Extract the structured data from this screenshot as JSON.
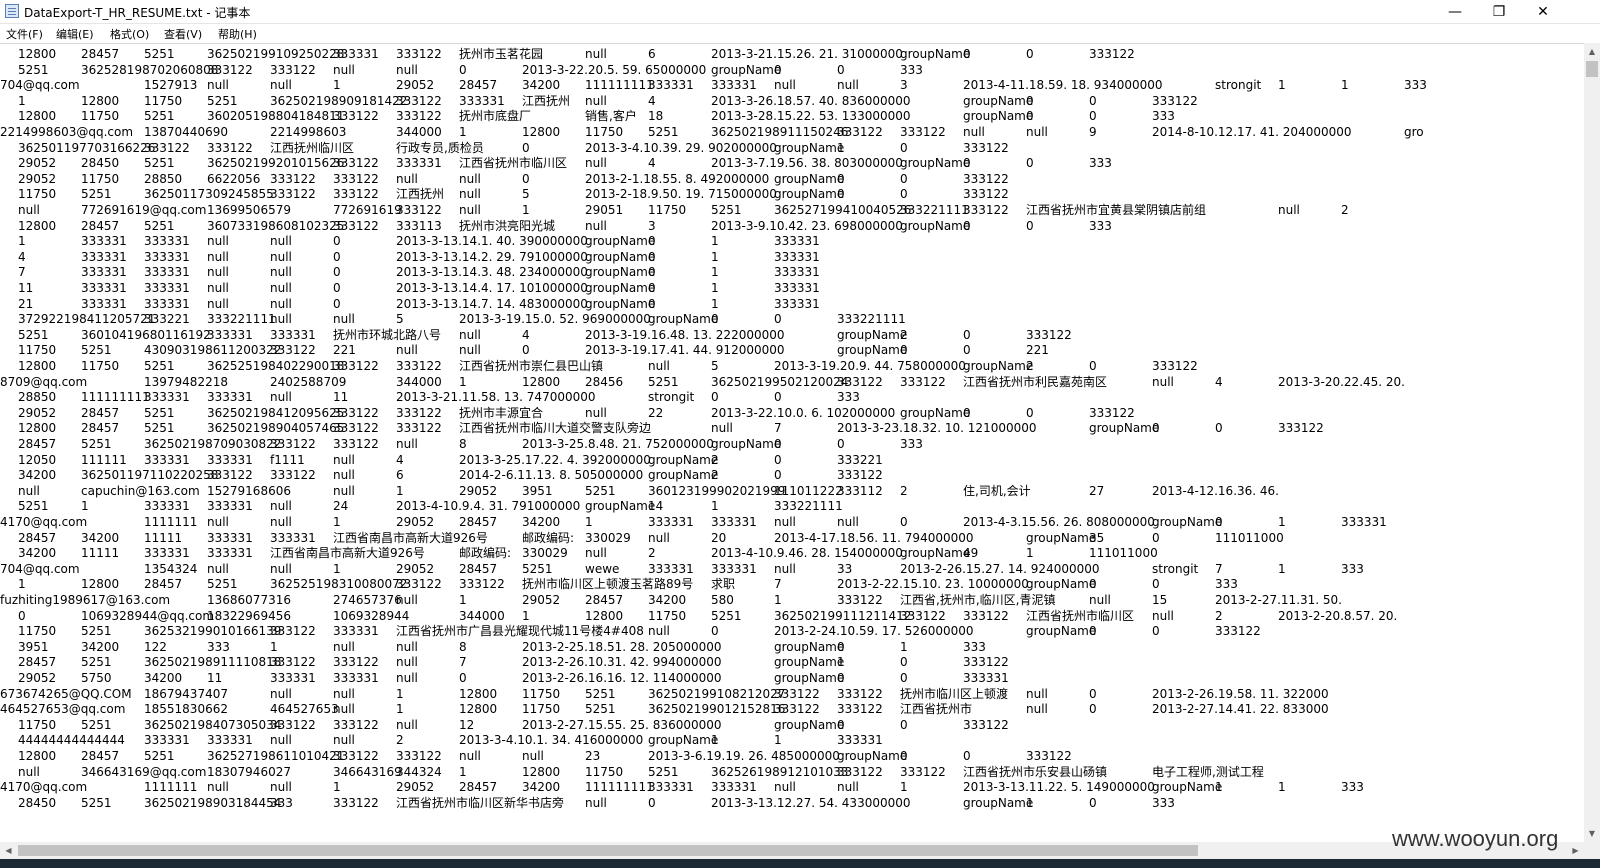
{
  "window": {
    "title": "DataExport-T_HR_RESUME.txt - 记事本",
    "minimize_glyph": "—",
    "maximize_glyph": "❐",
    "close_glyph": "✕"
  },
  "menu": [
    "文件(F)",
    "编辑(E)",
    "格式(O)",
    "查看(V)",
    "帮助(H)"
  ],
  "lines": [
    [
      "12800",
      "28457",
      "5251",
      "362502199109250228",
      "333331",
      "333122",
      "抚州市玉茗花园",
      "null",
      "6",
      "2013-3-21.15.26. 21. 31000000",
      "groupName",
      "0",
      "0",
      "333122"
    ],
    [
      "5251",
      "362528198702060808",
      "333122",
      "333122",
      "null",
      "null",
      "0",
      "2013-3-22.20.5. 59. 65000000",
      "groupName",
      "0",
      "0",
      "333"
    ],
    [
      "704@qq.com",
      "1527913",
      "null",
      "null",
      "1",
      "29052",
      "28457",
      "34200",
      "111111111",
      "333331",
      "333331",
      "null",
      "null",
      "3",
      "2013-4-11.18.59. 18. 934000000",
      "strongit",
      "1",
      "1",
      "333"
    ],
    [
      "1",
      "12800",
      "11750",
      "5251",
      "362502198909181422",
      "333122",
      "333331",
      "江西抚州",
      "null",
      "4",
      "2013-3-26.18.57. 40. 836000000",
      "groupName",
      "0",
      "0",
      "333122"
    ],
    [
      "12800",
      "11750",
      "5251",
      "360205198804184811",
      "333122",
      "333122",
      "抚州市底盘厂",
      "销售,客户",
      "18",
      "2013-3-28.15.22. 53. 133000000",
      "groupName",
      "0",
      "0",
      "333"
    ],
    [
      "2214998603@qq.com",
      "13870440690",
      "2214998603",
      "344000",
      "1",
      "12800",
      "11750",
      "5251",
      "362502198911150246",
      "333122",
      "333122",
      "null",
      "null",
      "9",
      "2014-8-10.12.17. 41. 204000000",
      "gro"
    ],
    [
      "362501197703166226",
      "333122",
      "333122",
      "江西抚州临川区",
      "行政专员,质检员",
      "0",
      "2013-3-4.10.39. 29. 902000000",
      "groupName",
      "1",
      "0",
      "333122"
    ],
    [
      "29052",
      "28450",
      "5251",
      "362502199201015626",
      "333122",
      "333331",
      "江西省抚州市临川区",
      "null",
      "4",
      "2013-3-7.19.56. 38. 803000000",
      "groupName",
      "0",
      "0",
      "333"
    ],
    [
      "29052",
      "11750",
      "28850",
      "6622056",
      "333122",
      "333122",
      "null",
      "null",
      "0",
      "2013-2-1.18.55. 8. 492000000",
      "groupName",
      "0",
      "0",
      "333122"
    ],
    [
      "11750",
      "5251",
      "36250117309245855",
      "333122",
      "333122",
      "江西抚州",
      "null",
      "5",
      "2013-2-18.9.50. 19. 715000000",
      "groupName",
      "0",
      "0",
      "333122"
    ],
    [
      "null",
      "772691619@qq.com",
      "13699506579",
      "772691619",
      "333122",
      "null",
      "1",
      "29051",
      "11750",
      "5251",
      "362527199410040526",
      "333221111",
      "333122",
      "江西省抚州市宜黄县棠阴镇店前组",
      "null",
      "2"
    ],
    [
      "12800",
      "28457",
      "5251",
      "360733198608102325",
      "333122",
      "333113",
      "抚州市洪亮阳光城",
      "null",
      "3",
      "2013-3-9.10.42. 23. 698000000",
      "groupName",
      "0",
      "0",
      "333"
    ],
    [
      "1",
      "333331",
      "333331",
      "null",
      "null",
      "0",
      "2013-3-13.14.1. 40. 390000000",
      "groupName",
      "0",
      "1",
      "333331"
    ],
    [
      "4",
      "333331",
      "333331",
      "null",
      "null",
      "0",
      "2013-3-13.14.2. 29. 791000000",
      "groupName",
      "0",
      "1",
      "333331"
    ],
    [
      "7",
      "333331",
      "333331",
      "null",
      "null",
      "0",
      "2013-3-13.14.3. 48. 234000000",
      "groupName",
      "0",
      "1",
      "333331"
    ],
    [
      "11",
      "333331",
      "333331",
      "null",
      "null",
      "0",
      "2013-3-13.14.4. 17. 101000000",
      "groupName",
      "0",
      "1",
      "333331"
    ],
    [
      "21",
      "333331",
      "333331",
      "null",
      "null",
      "0",
      "2013-3-13.14.7. 14. 483000000",
      "groupName",
      "0",
      "1",
      "333331"
    ],
    [
      "372922198411205721",
      "333221",
      "333221111",
      "null",
      "null",
      "5",
      "2013-3-19.15.0. 52. 969000000",
      "groupName",
      "0",
      "0",
      "333221111"
    ],
    [
      "5251",
      "36010419680116192",
      "333331",
      "333331",
      "抚州市环城北路八号",
      "null",
      "4",
      "2013-3-19.16.48. 13. 222000000",
      "groupName",
      "2",
      "0",
      "333122"
    ],
    [
      "11750",
      "5251",
      "430903198611200322",
      "333122",
      "221",
      "null",
      "null",
      "0",
      "2013-3-19.17.41. 44. 912000000",
      "groupName",
      "0",
      "0",
      "221"
    ],
    [
      "12800",
      "11750",
      "5251",
      "362525198402290018",
      "333122",
      "333122",
      "江西省抚州市崇仁县巴山镇",
      "null",
      "5",
      "2013-3-19.20.9. 44. 758000000",
      "groupName",
      "2",
      "0",
      "333122"
    ],
    [
      "8709@qq.com",
      "13979482218",
      "2402588709",
      "344000",
      "1",
      "12800",
      "28456",
      "5251",
      "362502199502120024",
      "333122",
      "333122",
      "江西省抚州市利民嘉苑南区",
      "null",
      "4",
      "2013-3-20.22.45. 20."
    ],
    [
      "28850",
      "111111111",
      "333331",
      "333331",
      "null",
      "11",
      "2013-3-21.11.58. 13. 747000000",
      "strongit",
      "0",
      "0",
      "333"
    ],
    [
      "29052",
      "28457",
      "5251",
      "362502198412095625",
      "333122",
      "333122",
      "抚州市丰源宜合",
      "null",
      "22",
      "2013-3-22.10.0. 6. 102000000",
      "groupName",
      "0",
      "0",
      "333122"
    ],
    [
      "12800",
      "28457",
      "5251",
      "362502198904057465",
      "333122",
      "333122",
      "江西省抚州市临川大道交警支队旁边",
      "null",
      "7",
      "2013-3-23.18.32. 10. 121000000",
      "groupName",
      "0",
      "0",
      "333122"
    ],
    [
      "28457",
      "5251",
      "362502198709030822",
      "333122",
      "333122",
      "null",
      "8",
      "2013-3-25.8.48. 21. 752000000",
      "groupName",
      "0",
      "0",
      "333"
    ],
    [
      "12050",
      "111111",
      "333331",
      "333331",
      "f1111",
      "null",
      "4",
      "2013-3-25.17.22. 4. 392000000",
      "groupName",
      "2",
      "0",
      "333221"
    ],
    [
      "34200",
      "362501197110220258",
      "333122",
      "333122",
      "null",
      "6",
      "2014-2-6.11.13. 8. 505000000",
      "groupName",
      "2",
      "0",
      "333122"
    ],
    [
      "null",
      "capuchin@163.com",
      "15279168606",
      "null",
      "1",
      "29052",
      "3951",
      "5251",
      "360123199902021999",
      "111011222",
      "333112",
      "2",
      "住,司机,会计",
      "27",
      "2013-4-12.16.36. 46."
    ],
    [
      "5251",
      "1",
      "333331",
      "333331",
      "null",
      "24",
      "2013-4-10.9.4. 31. 791000000",
      "groupName",
      "14",
      "1",
      "333221111"
    ],
    [
      "4170@qq.com",
      "1111111",
      "null",
      "null",
      "1",
      "29052",
      "28457",
      "34200",
      "1",
      "333331",
      "333331",
      "null",
      "null",
      "0",
      "2013-4-3.15.56. 26. 808000000",
      "groupName",
      "0",
      "1",
      "333331"
    ],
    [
      "28457",
      "34200",
      "11111",
      "333331",
      "333331",
      "江西省南昌市高新大道926号",
      "邮政编码:",
      "330029",
      "null",
      "20",
      "2013-4-17.18.56. 11. 794000000",
      "groupName",
      "35",
      "0",
      "111011000"
    ],
    [
      "34200",
      "11111",
      "333331",
      "333331",
      "江西省南昌市高新大道926号",
      "邮政编码:",
      "330029",
      "null",
      "2",
      "2013-4-10.9.46. 28. 154000000",
      "groupName",
      "49",
      "1",
      "111011000"
    ],
    [
      "704@qq.com",
      "1354324",
      "null",
      "null",
      "1",
      "29052",
      "28457",
      "5251",
      "wewe",
      "333331",
      "333331",
      "null",
      "33",
      "2013-2-26.15.27. 14. 924000000",
      "strongit",
      "7",
      "1",
      "333"
    ],
    [
      "1",
      "12800",
      "28457",
      "5251",
      "362525198310080072",
      "333122",
      "333122",
      "抚州市临川区上顿渡玉茗路89号",
      "求职",
      "7",
      "2013-2-22.15.10. 23. 10000000",
      "groupName",
      "0",
      "0",
      "333"
    ],
    [
      "fuzhiting1989617@163.com",
      "13686077316",
      "274657376",
      "null",
      "1",
      "29052",
      "28457",
      "34200",
      "580",
      "1",
      "333122",
      "江西省,抚州市,临川区,青泥镇",
      "null",
      "15",
      "2013-2-27.11.31. 50."
    ],
    [
      "0",
      "1069328944@qq.com",
      "18322969456",
      "1069328944",
      "344000",
      "1",
      "12800",
      "11750",
      "5251",
      "362502199111211412",
      "333122",
      "333122",
      "江西省抚州市临川区",
      "null",
      "2",
      "2013-2-20.8.57. 20."
    ],
    [
      "11750",
      "5251",
      "362532199010166139",
      "333122",
      "333331",
      "江西省抚州市广昌县光耀现代城11号楼4#408",
      "null",
      "0",
      "2013-2-24.10.59. 17. 526000000",
      "groupName",
      "0",
      "0",
      "333122"
    ],
    [
      "3951",
      "34200",
      "122",
      "333",
      "1",
      "null",
      "null",
      "8",
      "2013-2-25.18.51. 28. 205000000",
      "groupName",
      "0",
      "1",
      "333"
    ],
    [
      "28457",
      "5251",
      "362502198911110818",
      "333122",
      "333122",
      "null",
      "7",
      "2013-2-26.10.31. 42. 994000000",
      "groupName",
      "1",
      "0",
      "333122"
    ],
    [
      "29052",
      "5750",
      "34200",
      "11",
      "333331",
      "333331",
      "null",
      "0",
      "2013-2-26.16.16. 12. 114000000",
      "groupName",
      "0",
      "0",
      "333331"
    ],
    [
      "673674265@QQ.COM",
      "18679437407",
      "null",
      "null",
      "1",
      "12800",
      "11750",
      "5251",
      "362502199108212027",
      "333122",
      "333122",
      "抚州市临川区上顿渡",
      "null",
      "0",
      "2013-2-26.19.58. 11. 322000"
    ],
    [
      "464527653@qq.com",
      "18551830662",
      "464527653",
      "null",
      "1",
      "12800",
      "11750",
      "5251",
      "362502199012152816",
      "333122",
      "333122",
      "江西省抚州市",
      "null",
      "0",
      "2013-2-27.14.41. 22. 833000"
    ],
    [
      "11750",
      "5251",
      "362502198407305034",
      "333122",
      "333122",
      "null",
      "12",
      "2013-2-27.15.55. 25. 836000000",
      "groupName",
      "0",
      "0",
      "333122"
    ],
    [
      "44444444444444",
      "333331",
      "333331",
      "null",
      "null",
      "2",
      "2013-3-4.10.1. 34. 416000000",
      "groupName",
      "1",
      "1",
      "333331"
    ],
    [
      "12800",
      "28457",
      "5251",
      "362527198611010421",
      "333122",
      "333122",
      "null",
      "null",
      "23",
      "2013-3-6.19.19. 26. 485000000",
      "groupName",
      "0",
      "0",
      "333122"
    ],
    [
      "null",
      "346643169@qq.com",
      "18307946027",
      "346643169",
      "344324",
      "1",
      "12800",
      "11750",
      "5251",
      "362526198912101033",
      "333122",
      "333122",
      "江西省抚州市乐安县山砀镇",
      "电子工程师,测试工程"
    ],
    [
      "4170@qq.com",
      "1111111",
      "null",
      "null",
      "1",
      "29052",
      "28457",
      "34200",
      "111111111",
      "333331",
      "333331",
      "null",
      "null",
      "1",
      "2013-3-13.11.22. 5. 149000000",
      "groupName",
      "1",
      "1",
      "333"
    ],
    [
      "28450",
      "5251",
      "362502198903184454",
      "333",
      "333122",
      "江西省抚州市临川区新华书店旁",
      "null",
      "0",
      "2013-3-13.12.27. 54. 433000000",
      "groupName",
      "1",
      "0",
      "333"
    ]
  ],
  "watermark": "www.wooyun.org"
}
